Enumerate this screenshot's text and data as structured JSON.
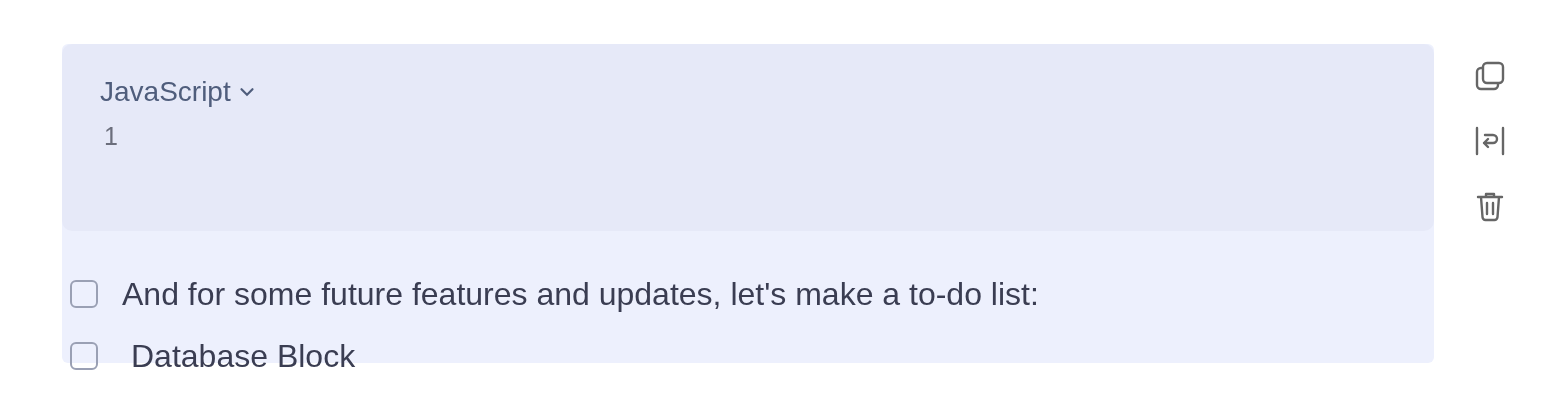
{
  "highlighted": true,
  "code_block": {
    "language": "JavaScript",
    "line_numbers": [
      "1"
    ]
  },
  "toolbar": [
    {
      "kind": "copy"
    },
    {
      "kind": "wrap"
    },
    {
      "kind": "delete"
    }
  ],
  "todos": [
    {
      "text": "And for some future features and updates, let's make a to-do list:",
      "checked": false
    },
    {
      "text": "Database Block",
      "checked": false
    }
  ]
}
